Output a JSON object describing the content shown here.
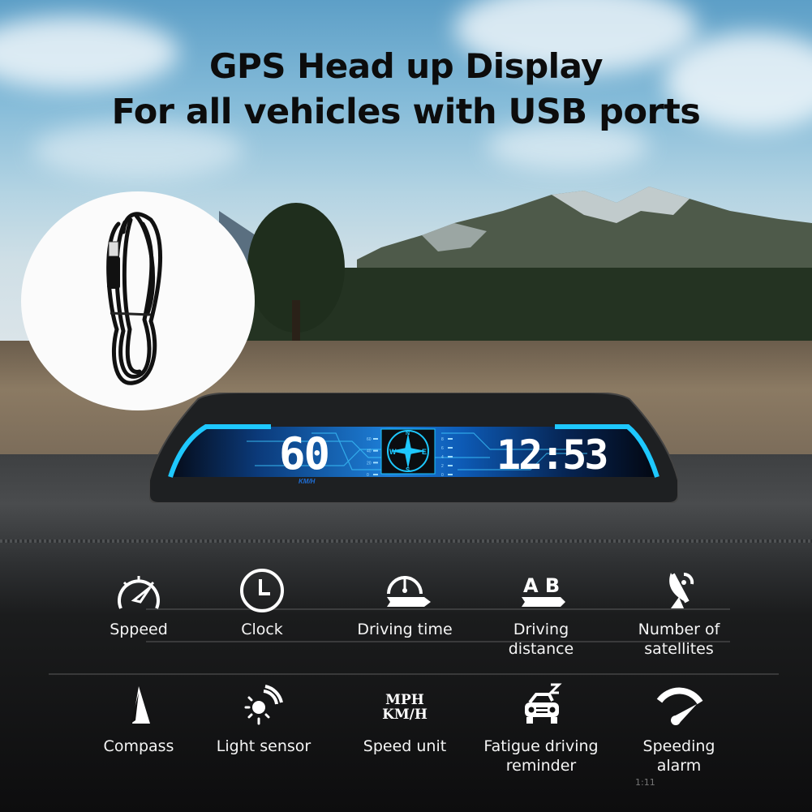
{
  "headline": {
    "line1": "GPS Head up Display",
    "line2": "For all vehicles with USB ports"
  },
  "accessory": {
    "name": "USB power cable",
    "icon": "usb-cable-icon"
  },
  "hud_display": {
    "speed_value": "60",
    "speed_unit": "KM/H",
    "clock_value": "12:53",
    "compass": {
      "n": "N",
      "s": "S",
      "e": "E",
      "w": "W"
    },
    "left_scale": [
      "60",
      "40",
      "20",
      "0"
    ],
    "right_scale": [
      "8",
      "6",
      "4",
      "2",
      "0"
    ],
    "accent_color": "#1ec8ff"
  },
  "features": [
    {
      "label": "Sppeed",
      "icon": "speedometer-icon"
    },
    {
      "label": "Clock",
      "icon": "clock-icon"
    },
    {
      "label": "Driving time",
      "icon": "driving-time-icon"
    },
    {
      "label": "Driving\ndistance",
      "line1": "Driving",
      "line2": "distance",
      "icon": "ab-distance-icon"
    },
    {
      "label": "Number of\nsatellites",
      "line1": "Number of",
      "line2": "satellites",
      "icon": "satellite-dish-icon"
    },
    {
      "label": "Compass",
      "icon": "compass-arrow-icon"
    },
    {
      "label": "Light sensor",
      "icon": "light-sensor-icon"
    },
    {
      "label": "Speed unit",
      "icon": "speed-unit-icon",
      "unit_top": "MPH",
      "unit_bottom": "KM/H"
    },
    {
      "label": "Fatigue driving\nreminder",
      "line1": "Fatigue driving",
      "line2": "reminder",
      "icon": "sleepy-car-icon"
    },
    {
      "label": "Speeding\nalarm",
      "line1": "Speeding",
      "line2": "alarm",
      "icon": "speeding-gauge-icon"
    }
  ],
  "console": {
    "time": "1:11"
  }
}
